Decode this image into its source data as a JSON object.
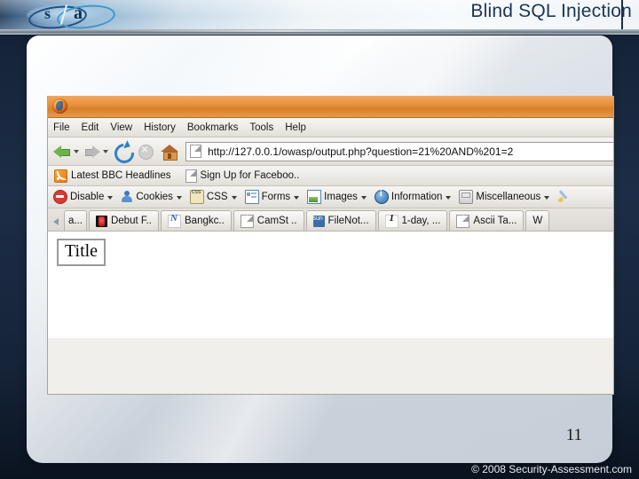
{
  "slide": {
    "title": "Blind SQL Injection",
    "number": "11",
    "copyright": "© 2008 Security-Assessment.com",
    "logo": {
      "letter_left": "s",
      "letter_right": "a"
    },
    "colors": {
      "background_dark": "#16243a",
      "header_light": "#eef4f8",
      "title_text": "#1b3551",
      "panel": "#c8d0d9",
      "browser_titlebar": "#e8933f"
    }
  },
  "browser": {
    "menu": [
      {
        "label": "File",
        "accel": "F"
      },
      {
        "label": "Edit",
        "accel": "E"
      },
      {
        "label": "View",
        "accel": "V"
      },
      {
        "label": "History",
        "accel": "s"
      },
      {
        "label": "Bookmarks",
        "accel": "B"
      },
      {
        "label": "Tools",
        "accel": "T"
      },
      {
        "label": "Help",
        "accel": "H"
      }
    ],
    "nav": {
      "back_icon": "back-arrow-icon",
      "forward_icon": "forward-arrow-icon",
      "reload_icon": "reload-icon",
      "stop_icon": "stop-icon",
      "home_icon": "home-icon"
    },
    "url": "http://127.0.0.1/owasp/output.php?question=21%20AND%201=2",
    "bookmarks": [
      {
        "label": "Latest BBC Headlines",
        "icon": "rss-feed-icon"
      },
      {
        "label": "Sign Up for Faceboo..",
        "icon": "page-icon"
      }
    ],
    "devtoolbar": [
      {
        "label": "Disable",
        "icon": "disable-icon"
      },
      {
        "label": "Cookies",
        "icon": "cookie-icon"
      },
      {
        "label": "CSS",
        "icon": "css-icon"
      },
      {
        "label": "Forms",
        "icon": "forms-icon"
      },
      {
        "label": "Images",
        "icon": "images-icon"
      },
      {
        "label": "Information",
        "icon": "information-icon"
      },
      {
        "label": "Miscellaneous",
        "icon": "miscellaneous-icon"
      }
    ],
    "devtoolbar_extra_icon": "paintbrush-icon",
    "tabs": [
      {
        "label": "a...",
        "icon": "none"
      },
      {
        "label": "Debut F..",
        "icon": "debut-icon"
      },
      {
        "label": "Bangkc..",
        "icon": "bangkok-icon"
      },
      {
        "label": "CamSt ..",
        "icon": "page-icon"
      },
      {
        "label": "FileNot...",
        "icon": "sun-icon"
      },
      {
        "label": "1-day, ...",
        "icon": "one-icon"
      },
      {
        "label": "Ascii Ta...",
        "icon": "page-icon"
      },
      {
        "label": "W",
        "icon": "none"
      }
    ],
    "page": {
      "title_box_text": "Title"
    }
  }
}
